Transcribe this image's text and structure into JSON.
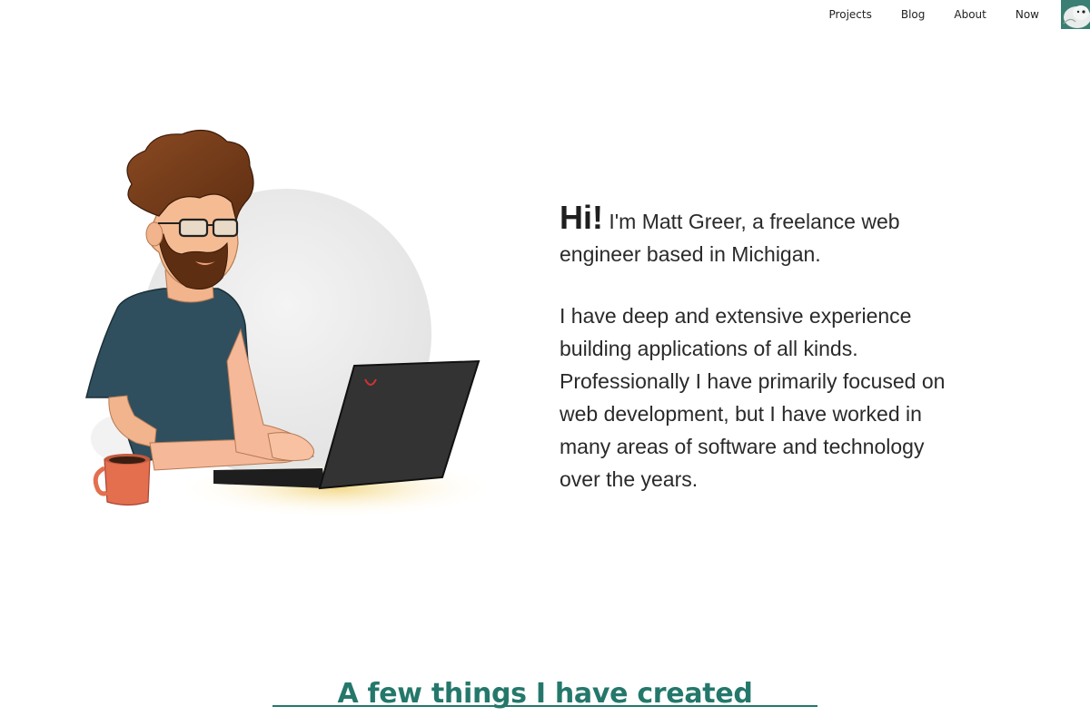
{
  "nav": {
    "items": [
      {
        "label": "Projects"
      },
      {
        "label": "Blog"
      },
      {
        "label": "About"
      },
      {
        "label": "Now"
      }
    ]
  },
  "hero": {
    "greeting": "Hi!",
    "intro": "I'm Matt Greer, a freelance web engineer based in Michigan.",
    "body": "I have deep and extensive experience building applications of all kinds. Professionally I have primarily focused on web development, but I have worked in many areas of software and technology over the years."
  },
  "section": {
    "title": "A few things I have created"
  },
  "colors": {
    "accent": "#24786b",
    "text": "#2a2a2a",
    "shirt": "#2f4f5e",
    "hair": "#7a3e1c",
    "mug": "#e36f4f",
    "laptop": "#333333"
  }
}
